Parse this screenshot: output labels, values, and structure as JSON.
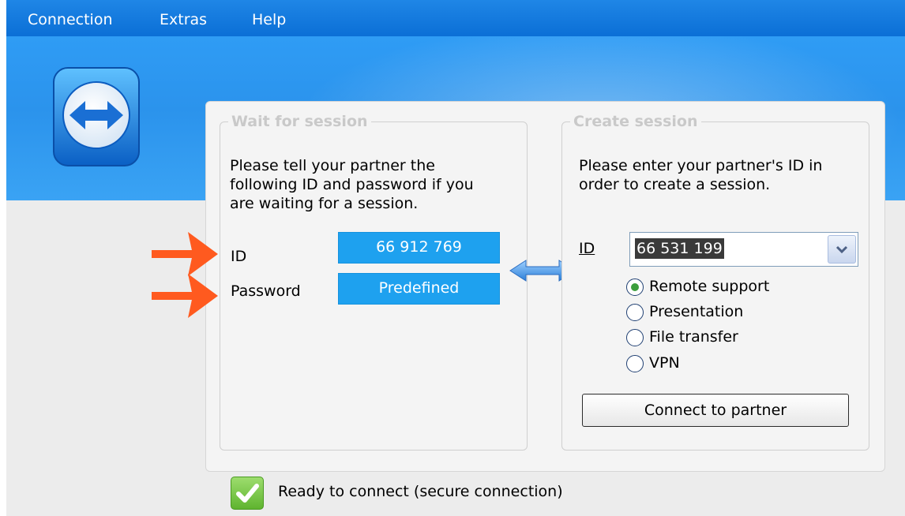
{
  "menu": {
    "items": [
      {
        "label": "Connection"
      },
      {
        "label": "Extras"
      },
      {
        "label": "Help"
      }
    ]
  },
  "wait_session": {
    "title": "Wait for session",
    "instructions_line1": "Please tell your partner the",
    "instructions_line2": "following ID and password if you",
    "instructions_line3": "are waiting for a session.",
    "id_label": "ID",
    "id_value": "66 912 769",
    "password_label": "Password",
    "password_value": "Predefined"
  },
  "create_session": {
    "title": "Create session",
    "instructions_line1": "Please enter your partner's ID in",
    "instructions_line2": "order to create a session.",
    "id_label": "ID",
    "id_value": "66 531 199",
    "modes": [
      {
        "label": "Remote support",
        "checked": true
      },
      {
        "label": "Presentation",
        "checked": false
      },
      {
        "label": "File transfer",
        "checked": false
      },
      {
        "label": "VPN",
        "checked": false
      }
    ],
    "connect_button": "Connect to partner"
  },
  "status": {
    "text": "Ready to connect (secure connection)",
    "icon": "check-icon"
  },
  "colors": {
    "menubar": "#0b6fd6",
    "banner": "#2f9cf5",
    "id_box": "#1ea1ef",
    "arrow_annotation": "#ff5a1f",
    "radio_checked": "#3c9e3c"
  }
}
